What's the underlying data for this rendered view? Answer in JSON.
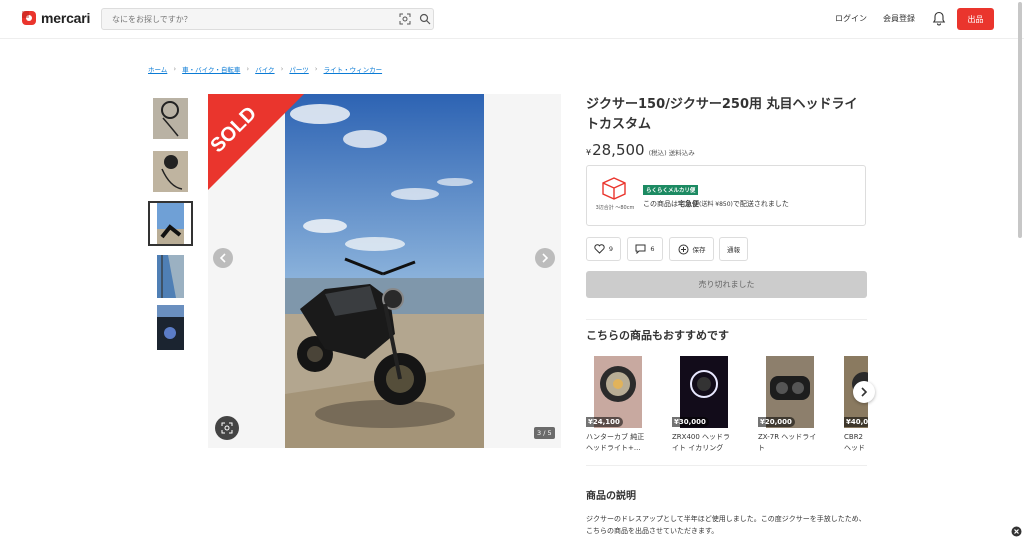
{
  "header": {
    "logo_text": "mercari",
    "search_placeholder": "なにをお探しですか？",
    "login_label": "ログイン",
    "signup_label": "会員登録",
    "sell_label": "出品"
  },
  "breadcrumb": [
    "ホーム",
    "車・バイク・自転車",
    "バイク",
    "パーツ",
    "ライト・ウィンカー"
  ],
  "gallery": {
    "sold_label": "SOLD",
    "counter": "3 / 5",
    "thumbnail_count": 5,
    "selected_thumbnail": 3
  },
  "item": {
    "title": "ジクサー150/ジクサー250用 丸目ヘッドライトカスタム",
    "price_symbol": "¥",
    "price": "28,500",
    "price_note": "(税込) 送料込み",
    "shipping_size": "3辺合計 〜80cm",
    "shipping_badge": "らくらくメルカリ便",
    "shipping_pre": "この商品は",
    "shipping_method": "宅急便",
    "shipping_fee": "(送料 ¥850)",
    "shipping_post": "で配送されました",
    "likes": "9",
    "comments": "6",
    "save_label": "保存",
    "report_label": "通報",
    "soldout_label": "売り切れました"
  },
  "recommend": {
    "title": "こちらの商品もおすすめです",
    "items": [
      {
        "price": "¥24,100",
        "name": "ハンターカブ 純正ヘッドライト+..."
      },
      {
        "price": "¥30,000",
        "name": "ZRX400 ヘッドライト イカリング"
      },
      {
        "price": "¥20,000",
        "name": "ZX-7R ヘッドライト"
      },
      {
        "price": "¥40,0",
        "name": "CBR2 ヘッド"
      }
    ]
  },
  "description": {
    "title": "商品の説明",
    "body": "ジクサーのドレスアップとして半年ほど使用しました。この度ジクサーを手放したため、こちらの商品を出品させていただきます。"
  },
  "colors": {
    "brand_red": "#ea352d",
    "link_blue": "#0b7bd5",
    "badge_green": "#1c8a62",
    "soldout_gray": "#cccccc"
  }
}
